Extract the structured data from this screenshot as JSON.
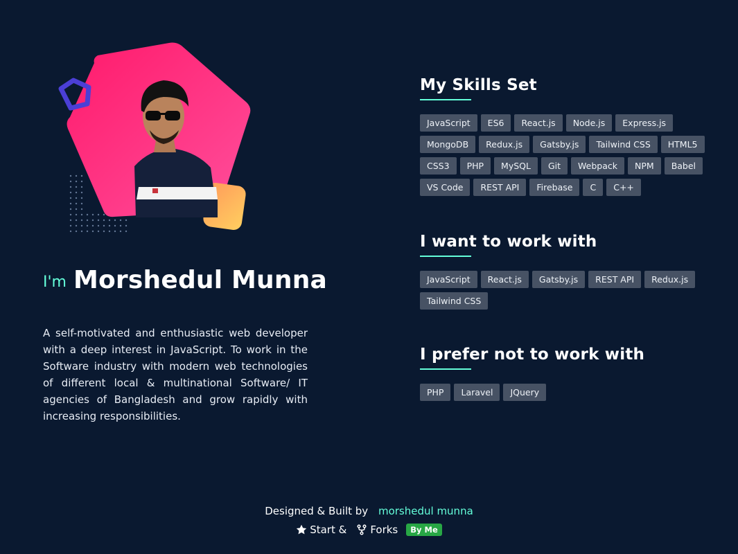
{
  "hero": {
    "greeting": "I'm",
    "name": "Morshedul Munna",
    "bio": "A self-motivated and enthusiastic web developer with a deep interest in JavaScript. To work in the Software industry with modern web technologies of different local & multinational Software/ IT agencies of Bangladesh and grow rapidly with increasing responsibilities."
  },
  "skills": {
    "title": "My Skills Set",
    "tags": [
      "JavaScript",
      "ES6",
      "React.js",
      "Node.js",
      "Express.js",
      "MongoDB",
      "Redux.js",
      "Gatsby.js",
      "Tailwind CSS",
      "HTML5",
      "CSS3",
      "PHP",
      "MySQL",
      "Git",
      "Webpack",
      "NPM",
      "Babel",
      "VS Code",
      "REST API",
      "Firebase",
      "C",
      "C++"
    ]
  },
  "want": {
    "title": "I want to work with",
    "tags": [
      "JavaScript",
      "React.js",
      "Gatsby.js",
      "REST API",
      "Redux.js",
      "Tailwind CSS"
    ]
  },
  "avoid": {
    "title": "I prefer not to work with",
    "tags": [
      "PHP",
      "Laravel",
      "JQuery"
    ]
  },
  "footer": {
    "credit_prefix": "Designed & Built by",
    "credit_name": "morshedul munna",
    "star_label": "Start &",
    "forks_label": "Forks",
    "badge": "By Me"
  },
  "colors": {
    "background": "#0a1930",
    "accent": "#64ffda",
    "tag_bg": "#475264",
    "badge_bg": "#28a745",
    "pentagon_start": "#ff1a75",
    "pentagon_end": "#ff4d9a"
  },
  "icons": {
    "star": "star-icon",
    "fork": "fork-icon"
  }
}
